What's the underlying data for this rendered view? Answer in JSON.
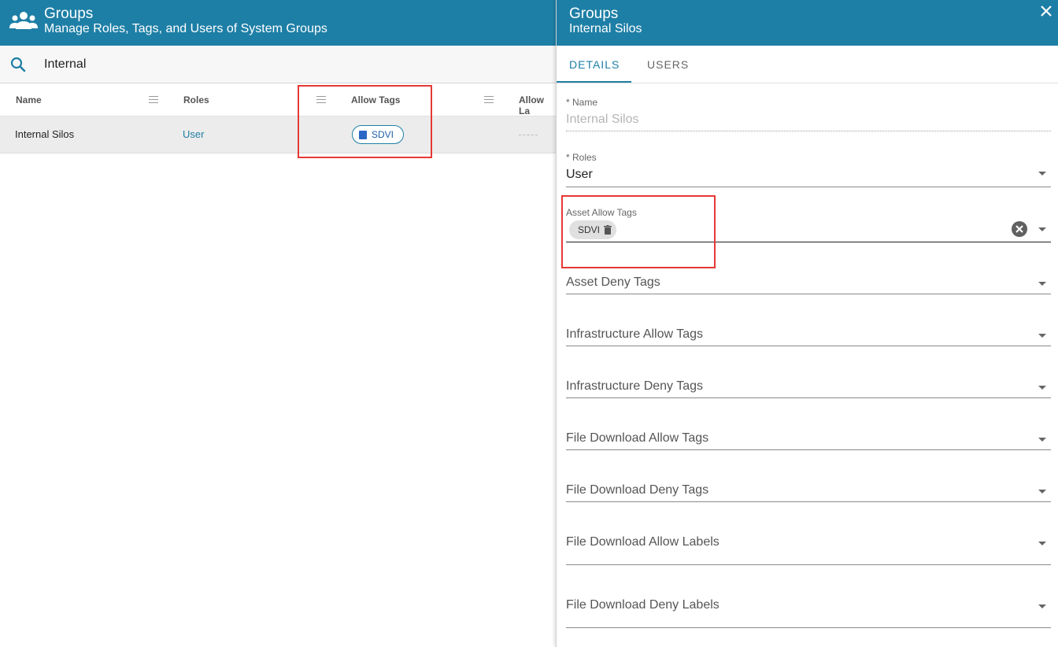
{
  "app": {
    "title": "Groups",
    "subtitle": "Manage Roles, Tags, and Users of System Groups"
  },
  "search": {
    "value": "Internal",
    "placeholder": ""
  },
  "grid": {
    "columns": [
      "Name",
      "Roles",
      "Allow Tags",
      "Allow La"
    ],
    "rows": [
      {
        "name": "Internal Silos",
        "roles": "User",
        "allow_tags": [
          "SDVI"
        ],
        "allow_labels": ""
      }
    ]
  },
  "panel": {
    "title": "Groups",
    "subtitle": "Internal Silos",
    "tabs": [
      {
        "label": "DETAILS",
        "active": true
      },
      {
        "label": "USERS",
        "active": false
      }
    ],
    "fields": {
      "name": {
        "label": "* Name",
        "value": "Internal Silos"
      },
      "roles": {
        "label": "* Roles",
        "value": "User"
      },
      "asset_allow_tags": {
        "label": "Asset Allow Tags",
        "chips": [
          "SDVI"
        ]
      },
      "asset_deny_tags": {
        "label": "Asset Deny Tags"
      },
      "infrastructure_allow_tags": {
        "label": "Infrastructure Allow Tags"
      },
      "infrastructure_deny_tags": {
        "label": "Infrastructure Deny Tags"
      },
      "file_download_allow_tags": {
        "label": "File Download Allow Tags"
      },
      "file_download_deny_tags": {
        "label": "File Download Deny Tags"
      },
      "file_download_allow_labels": {
        "label": "File Download Allow Labels"
      },
      "file_download_deny_labels": {
        "label": "File Download Deny Labels"
      }
    }
  },
  "colors": {
    "header_bg": "#1e7fa6",
    "accent": "#1e7fa6",
    "highlight_box": "#e53935",
    "row_selected_bg": "#ececec"
  },
  "icons": [
    "groups-icon",
    "search-icon",
    "column-menu-icon",
    "tag-icon",
    "close-icon",
    "trash-icon",
    "clear-icon",
    "dropdown-arrow-icon"
  ]
}
